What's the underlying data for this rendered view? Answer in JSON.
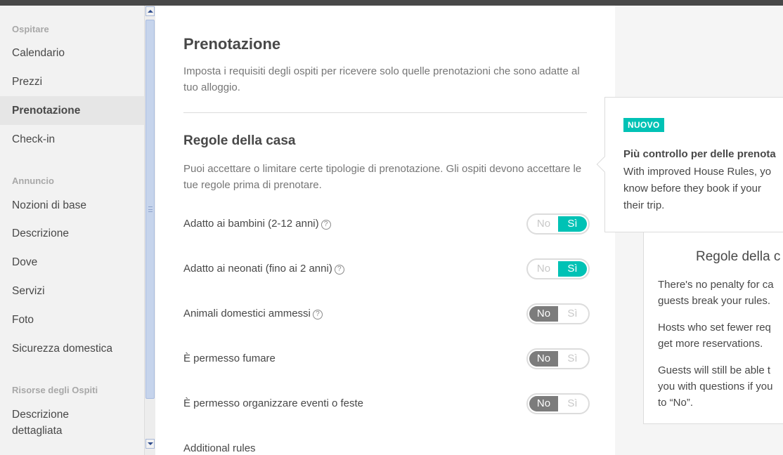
{
  "sidebar": {
    "sections": [
      {
        "label": "Ospitare",
        "items": [
          "Calendario",
          "Prezzi",
          "Prenotazione",
          "Check-in"
        ]
      },
      {
        "label": "Annuncio",
        "items": [
          "Nozioni di base",
          "Descrizione",
          "Dove",
          "Servizi",
          "Foto",
          "Sicurezza domestica"
        ]
      },
      {
        "label": "Risorse degli Ospiti",
        "items": [
          "Descrizione\ndettagliata"
        ]
      }
    ],
    "active_item": "Prenotazione"
  },
  "main": {
    "title": "Prenotazione",
    "description": "Imposta i requisiti degli ospiti per ricevere solo quelle prenotazioni che sono adatte al tuo alloggio.",
    "house_rules": {
      "title": "Regole della casa",
      "description": "Puoi accettare o limitare certe tipologie di prenotazione. Gli ospiti devono accettare le tue regole prima di prenotare.",
      "rules": [
        {
          "label": "Adatto ai bambini (2-12 anni)",
          "help": true,
          "value": "Sì"
        },
        {
          "label": "Adatto ai neonati (fino ai 2 anni)",
          "help": true,
          "value": "Sì"
        },
        {
          "label": "Animali domestici ammessi",
          "help": true,
          "value": "No"
        },
        {
          "label": "È permesso fumare",
          "help": false,
          "value": "No"
        },
        {
          "label": "È permesso organizzare eventi o feste",
          "help": false,
          "value": "No"
        }
      ],
      "toggle_no": "No",
      "toggle_yes": "Sì",
      "help_glyph": "?"
    },
    "additional_rules": "Additional rules"
  },
  "popover": {
    "badge": "NUOVO",
    "title": "Più controllo per delle prenota",
    "body": "With improved House Rules, yo\nknow before they book if your\ntheir trip."
  },
  "info_card": {
    "title": "Regole della c",
    "paragraphs": [
      "There's no penalty for ca\nguests break your rules.",
      "Hosts who set fewer req\nget more reservations.",
      "Guests will still be able t\nyou with questions if you\nto “No”."
    ]
  },
  "colors": {
    "accent": "#00c2b5",
    "toggle_off": "#7c7c7c",
    "sidebar_bg": "#f2f2f2",
    "text": "#484848"
  }
}
